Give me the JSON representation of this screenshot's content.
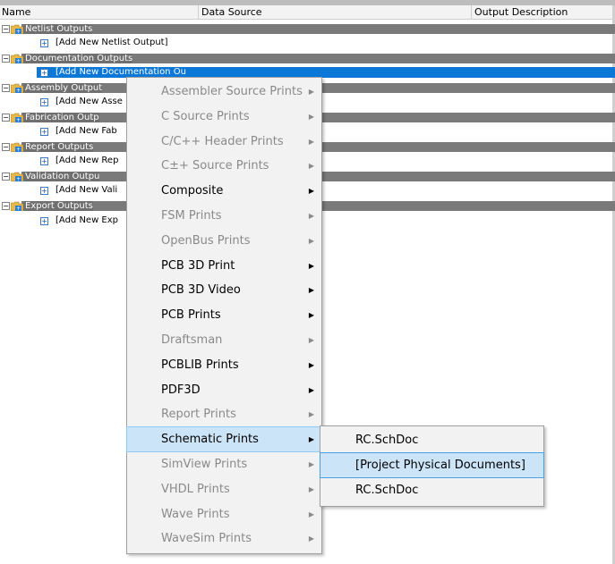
{
  "header": {
    "col_name": "Name",
    "col_source": "Data Source",
    "col_desc": "Output Description"
  },
  "tree": {
    "groups": [
      {
        "label": "Netlist Outputs",
        "add": "[Add New Netlist Output]"
      },
      {
        "label": "Documentation Outputs",
        "add": "[Add New Documentation Ou"
      },
      {
        "label": "Assembly Output",
        "add": "[Add New Asse"
      },
      {
        "label": "Fabrication Outp",
        "add": "[Add New Fab"
      },
      {
        "label": "Report Outputs",
        "add": "[Add New Rep"
      },
      {
        "label": "Validation Outpu",
        "add": "[Add New Vali"
      },
      {
        "label": "Export Outputs",
        "add": "[Add New Exp"
      }
    ]
  },
  "context_menu": {
    "items": [
      {
        "label": "Assembler Source Prints",
        "enabled": false
      },
      {
        "label": "C Source Prints",
        "enabled": false
      },
      {
        "label": "C/C++ Header Prints",
        "enabled": false
      },
      {
        "label": "C±+ Source Prints",
        "enabled": false
      },
      {
        "label": "Composite",
        "enabled": true
      },
      {
        "label": "FSM Prints",
        "enabled": false
      },
      {
        "label": "OpenBus Prints",
        "enabled": false
      },
      {
        "label": "PCB 3D Print",
        "enabled": true
      },
      {
        "label": "PCB 3D Video",
        "enabled": true
      },
      {
        "label": "PCB Prints",
        "enabled": true
      },
      {
        "label": "Draftsman",
        "enabled": false
      },
      {
        "label": "PCBLIB Prints",
        "enabled": true
      },
      {
        "label": "PDF3D",
        "enabled": true
      },
      {
        "label": "Report Prints",
        "enabled": false
      },
      {
        "label": "Schematic Prints",
        "enabled": true
      },
      {
        "label": "SimView Prints",
        "enabled": false
      },
      {
        "label": "VHDL Prints",
        "enabled": false
      },
      {
        "label": "Wave Prints",
        "enabled": false
      },
      {
        "label": "WaveSim Prints",
        "enabled": false
      }
    ],
    "arrow": "▶"
  },
  "submenu": {
    "items": [
      {
        "label": "RC.SchDoc"
      },
      {
        "label": "[Project Physical Documents]"
      },
      {
        "label": "RC.SchDoc"
      }
    ]
  },
  "glyphs": {
    "expander": "−",
    "add": "+"
  },
  "colors": {
    "group_bar": "#7a7a7a",
    "selection": "#0b78d8",
    "menu_highlight": "#cce4f7",
    "menu_bg": "#f2f2f2",
    "disabled_text": "#8a8a8a"
  }
}
